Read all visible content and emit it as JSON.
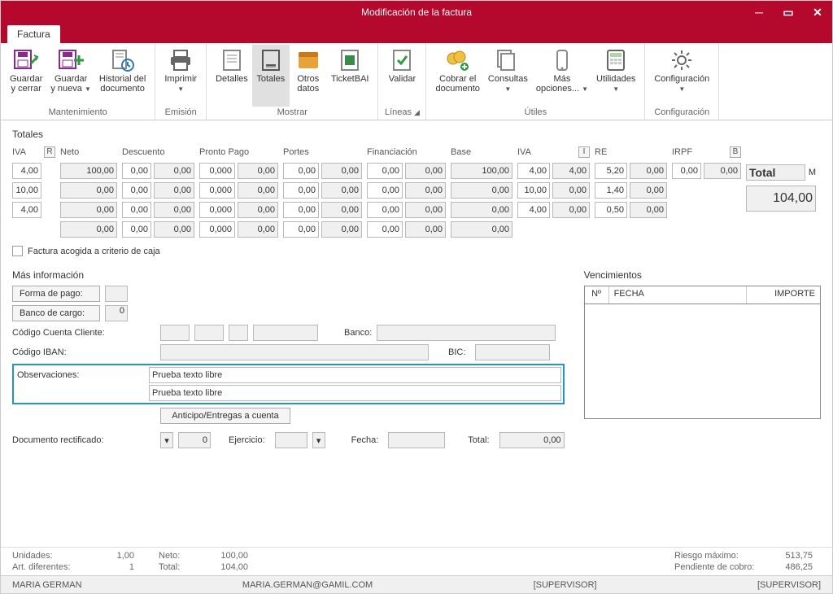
{
  "window": {
    "title": "Modificación de la factura"
  },
  "tabs": {
    "main": "Factura"
  },
  "ribbon": {
    "groups": [
      {
        "label": "Mantenimiento",
        "buttons": [
          {
            "id": "save-close",
            "line1": "Guardar",
            "line2": "y cerrar",
            "dd": false
          },
          {
            "id": "save-new",
            "line1": "Guardar",
            "line2": "y nueva",
            "dd": true
          },
          {
            "id": "history",
            "line1": "Historial del",
            "line2": "documento",
            "dd": false
          }
        ]
      },
      {
        "label": "Emisión",
        "buttons": [
          {
            "id": "print",
            "line1": "Imprimir",
            "line2": "",
            "dd": true
          }
        ]
      },
      {
        "label": "Mostrar",
        "buttons": [
          {
            "id": "details",
            "line1": "Detalles",
            "line2": "",
            "dd": false
          },
          {
            "id": "totals",
            "line1": "Totales",
            "line2": "",
            "dd": false,
            "active": true
          },
          {
            "id": "other",
            "line1": "Otros",
            "line2": "datos",
            "dd": false
          },
          {
            "id": "ticketbai",
            "line1": "TicketBAI",
            "line2": "",
            "dd": false
          }
        ]
      },
      {
        "label": "Líneas",
        "ext": true,
        "buttons": [
          {
            "id": "validate",
            "line1": "Validar",
            "line2": "",
            "dd": false
          }
        ]
      },
      {
        "label": "Útiles",
        "buttons": [
          {
            "id": "cobrar",
            "line1": "Cobrar el",
            "line2": "documento",
            "dd": false
          },
          {
            "id": "consultas",
            "line1": "Consultas",
            "line2": "",
            "dd": true
          },
          {
            "id": "masopc",
            "line1": "Más",
            "line2": "opciones...",
            "dd": true
          },
          {
            "id": "utilidades",
            "line1": "Utilidades",
            "line2": "",
            "dd": true
          }
        ]
      },
      {
        "label": "Configuración",
        "buttons": [
          {
            "id": "config",
            "line1": "Configuración",
            "line2": "",
            "dd": true
          }
        ]
      }
    ]
  },
  "totals": {
    "title": "Totales",
    "headers": {
      "iva": "IVA",
      "r": "R",
      "neto": "Neto",
      "desc": "Descuento",
      "pp": "Pronto Pago",
      "portes": "Portes",
      "fin": "Financiación",
      "base": "Base",
      "i": "I",
      "re": "RE",
      "irpf": "IRPF",
      "b": "B"
    },
    "rows": [
      {
        "ivaPct": "4,00",
        "neto": "100,00",
        "descP": "0,00",
        "descV": "0,00",
        "ppP": "0,000",
        "ppV": "0,00",
        "porP": "0,00",
        "porV": "0,00",
        "finP": "0,00",
        "finV": "0,00",
        "base": "100,00",
        "ivaP2": "4,00",
        "ivaV": "4,00",
        "reP": "5,20",
        "reV": "0,00",
        "irpfP": "0,00",
        "irpfV": "0,00"
      },
      {
        "ivaPct": "10,00",
        "neto": "0,00",
        "descP": "0,00",
        "descV": "0,00",
        "ppP": "0,000",
        "ppV": "0,00",
        "porP": "0,00",
        "porV": "0,00",
        "finP": "0,00",
        "finV": "0,00",
        "base": "0,00",
        "ivaP2": "10,00",
        "ivaV": "0,00",
        "reP": "1,40",
        "reV": "0,00",
        "irpfP": "",
        "irpfV": ""
      },
      {
        "ivaPct": "4,00",
        "neto": "0,00",
        "descP": "0,00",
        "descV": "0,00",
        "ppP": "0,000",
        "ppV": "0,00",
        "porP": "0,00",
        "porV": "0,00",
        "finP": "0,00",
        "finV": "0,00",
        "base": "0,00",
        "ivaP2": "4,00",
        "ivaV": "0,00",
        "reP": "0,50",
        "reV": "0,00",
        "irpfP": "",
        "irpfV": ""
      },
      {
        "ivaPct": "",
        "neto": "0,00",
        "descP": "0,00",
        "descV": "0,00",
        "ppP": "0,000",
        "ppV": "0,00",
        "porP": "0,00",
        "porV": "0,00",
        "finP": "0,00",
        "finV": "0,00",
        "base": "0,00",
        "ivaP2": "",
        "ivaV": "",
        "reP": "",
        "reV": "",
        "irpfP": "",
        "irpfV": ""
      }
    ],
    "totalLabel": "Total",
    "m": "M",
    "totalValue": "104,00",
    "checkbox": "Factura acogida a criterio de caja"
  },
  "moreinfo": {
    "title": "Más información",
    "formaPago": "Forma de pago:",
    "bancoCargo": "Banco de cargo:",
    "bancoCargoVal": "0",
    "ccc": "Código Cuenta Cliente:",
    "bancoLbl": "Banco:",
    "iban": "Código IBAN:",
    "bic": "BIC:",
    "obs": "Observaciones:",
    "obs1": "Prueba texto libre",
    "obs2": "Prueba texto libre",
    "anticipo": "Anticipo/Entregas a cuenta",
    "docRect": "Documento rectificado:",
    "docRectVal": "0",
    "ejercicio": "Ejercicio:",
    "fecha": "Fecha:",
    "totalLbl": "Total:",
    "totalVal": "0,00"
  },
  "venc": {
    "title": "Vencimientos",
    "hdr": {
      "n": "Nº",
      "fecha": "FECHA",
      "importe": "IMPORTE"
    }
  },
  "footer": {
    "unidades": "Unidades:",
    "unidadesV": "1,00",
    "art": "Art. diferentes:",
    "artV": "1",
    "neto": "Neto:",
    "netoV": "100,00",
    "total": "Total:",
    "totalV": "104,00",
    "riesgo": "Riesgo máximo:",
    "riesgoV": "513,75",
    "pend": "Pendiente de cobro:",
    "pendV": "486,25"
  },
  "status": {
    "user": "MARIA GERMAN",
    "email": "MARIA.GERMAN@GAMIL.COM",
    "s1": "[SUPERVISOR]",
    "s2": "[SUPERVISOR]"
  }
}
